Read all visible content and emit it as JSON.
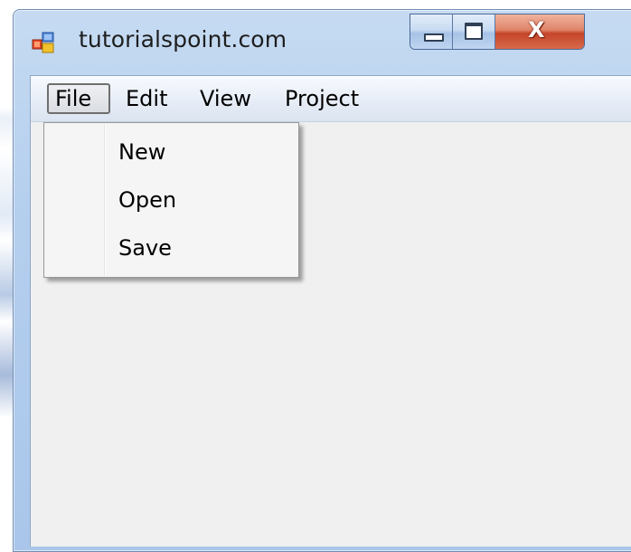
{
  "window": {
    "title": "tutorialspoint.com",
    "close_glyph": "X",
    "icons": {
      "app": "app-icon",
      "minimize": "minimize-icon",
      "maximize": "maximize-icon",
      "close": "close-icon"
    }
  },
  "menubar": {
    "items": [
      {
        "label": "File",
        "active": true
      },
      {
        "label": "Edit"
      },
      {
        "label": "View"
      },
      {
        "label": "Project"
      }
    ]
  },
  "file_menu": {
    "items": [
      {
        "label": "New"
      },
      {
        "label": "Open"
      },
      {
        "label": "Save"
      }
    ]
  },
  "colors": {
    "titlebar": "#b5cfee",
    "client_background": "#f0f0f0",
    "close_button": "#c5452a"
  }
}
